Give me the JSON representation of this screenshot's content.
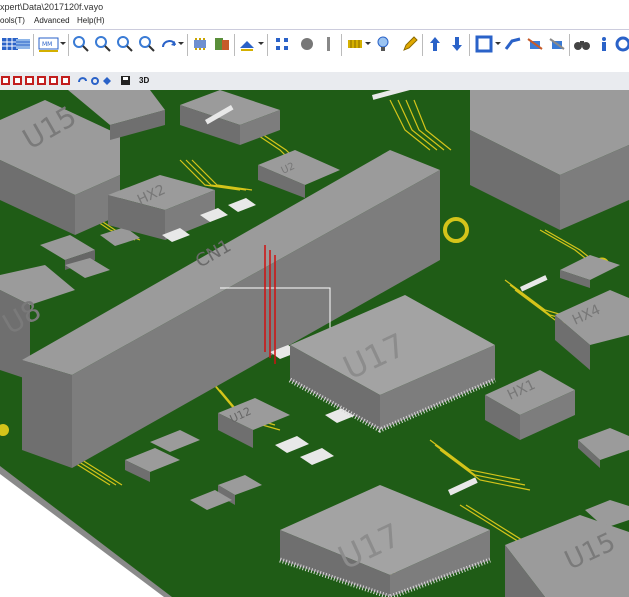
{
  "window": {
    "title": "xpert\\Data\\2017120f.vayo"
  },
  "menu": {
    "tools": "ools(T)",
    "advanced": "Advanced",
    "help": "Help(H)"
  },
  "toolbar2": {
    "view_3d_label": "3D"
  },
  "board": {
    "labels": {
      "u15": "U15",
      "hx2": "HX2",
      "cn1": "CN1",
      "u2": "U2",
      "u17": "U17",
      "u12": "U12",
      "hx4": "HX4",
      "hx1": "HX1",
      "u8": "U8",
      "u17b": "U17",
      "u15b": "U15"
    }
  },
  "colors": {
    "pcb": "#1f5c16",
    "component": "#8a8a8a",
    "trace": "#d4c41a",
    "accent": "#2a62c8"
  }
}
